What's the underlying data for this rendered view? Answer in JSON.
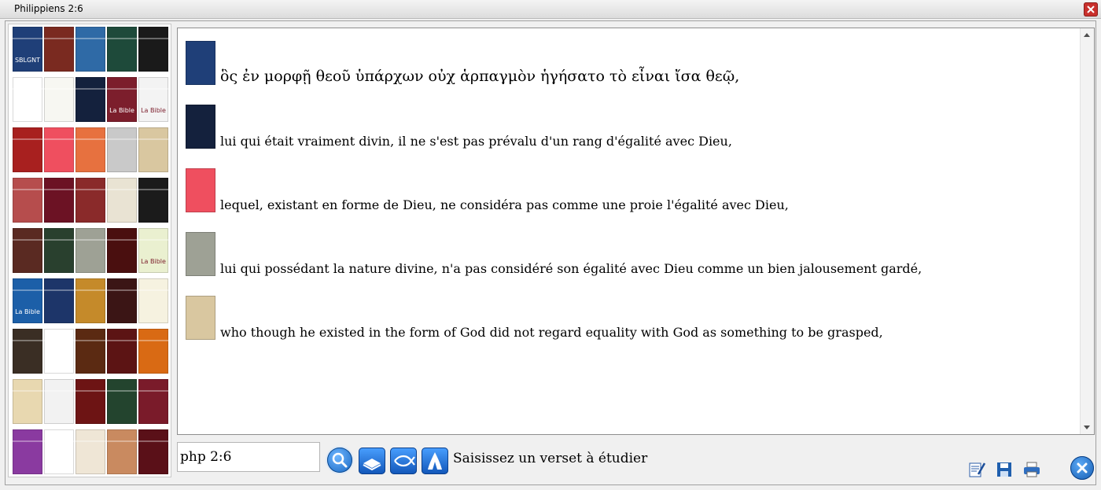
{
  "window": {
    "title": "Philippiens 2:6"
  },
  "books": [
    {
      "bg": "#1f3f78",
      "label": "SBLGNT"
    },
    {
      "bg": "#7a2a20",
      "label": ""
    },
    {
      "bg": "#2f6aa6",
      "label": ""
    },
    {
      "bg": "#1e4a3a",
      "label": ""
    },
    {
      "bg": "#1a1a1a",
      "label": ""
    },
    {
      "bg": "#ffffff",
      "label": ""
    },
    {
      "bg": "#f7f7f2",
      "label": ""
    },
    {
      "bg": "#14213d",
      "label": ""
    },
    {
      "bg": "#7c1e2c",
      "label": "La Bible"
    },
    {
      "bg": "#f3f3f3",
      "label": "La Bible"
    },
    {
      "bg": "#a8201f",
      "label": ""
    },
    {
      "bg": "#ef4f5f",
      "label": ""
    },
    {
      "bg": "#e7713f",
      "label": ""
    },
    {
      "bg": "#c9c9c9",
      "label": ""
    },
    {
      "bg": "#d9c7a0",
      "label": ""
    },
    {
      "bg": "#b64d4d",
      "label": ""
    },
    {
      "bg": "#6c1224",
      "label": ""
    },
    {
      "bg": "#8a2a2a",
      "label": ""
    },
    {
      "bg": "#e9e3d3",
      "label": ""
    },
    {
      "bg": "#1b1b1b",
      "label": ""
    },
    {
      "bg": "#5a2a22",
      "label": ""
    },
    {
      "bg": "#29402e",
      "label": ""
    },
    {
      "bg": "#9ea195",
      "label": ""
    },
    {
      "bg": "#4a0f0f",
      "label": ""
    },
    {
      "bg": "#eaf0d0",
      "label": "La Bible"
    },
    {
      "bg": "#1c5fa8",
      "label": "La Bible"
    },
    {
      "bg": "#1d3569",
      "label": ""
    },
    {
      "bg": "#c58a2a",
      "label": ""
    },
    {
      "bg": "#3b1515",
      "label": ""
    },
    {
      "bg": "#f6f2e0",
      "label": ""
    },
    {
      "bg": "#3a2e24",
      "label": ""
    },
    {
      "bg": "#ffffff",
      "label": ""
    },
    {
      "bg": "#5b2a12",
      "label": ""
    },
    {
      "bg": "#5c1414",
      "label": ""
    },
    {
      "bg": "#d96a14",
      "label": ""
    },
    {
      "bg": "#e8d8b0",
      "label": ""
    },
    {
      "bg": "#f2f2f2",
      "label": ""
    },
    {
      "bg": "#6d1414",
      "label": ""
    },
    {
      "bg": "#23442e",
      "label": ""
    },
    {
      "bg": "#7a1b2a",
      "label": ""
    },
    {
      "bg": "#8a3aa0",
      "label": ""
    },
    {
      "bg": "#ffffff",
      "label": ""
    },
    {
      "bg": "#efe6d6",
      "label": ""
    },
    {
      "bg": "#c98a60",
      "label": ""
    },
    {
      "bg": "#5a1018",
      "label": ""
    }
  ],
  "verses": [
    {
      "cover": "#1f3f78",
      "text": "ὃς ἐν μορφῇ θεοῦ ὑπάρχων οὐχ ἁρπαγμὸν ἡγήσατο τὸ εἶναι ἴσα θεῷ,",
      "greek": true
    },
    {
      "cover": "#14213d",
      "text": "lui qui était vraiment divin, il ne s'est pas prévalu d'un rang d'égalité avec Dieu,",
      "greek": false
    },
    {
      "cover": "#ef4f5f",
      "text": "lequel, existant en forme de Dieu, ne considéra pas comme une proie l'égalité avec Dieu,",
      "greek": false
    },
    {
      "cover": "#9ea195",
      "text": "lui qui possédant la nature divine, n'a pas considéré son égalité avec Dieu comme un bien jalousement gardé,",
      "greek": false
    },
    {
      "cover": "#d9c7a0",
      "text": "who though he existed in the form of God did not regard equality with God as something to be grasped,",
      "greek": false
    }
  ],
  "search": {
    "value": "php 2:6",
    "prompt": "Saisissez un verset à étudier"
  },
  "icons": [
    "search-icon",
    "book-icon",
    "fish-icon",
    "prayer-icon",
    "edit-icon",
    "save-icon",
    "print-icon",
    "close-icon"
  ]
}
